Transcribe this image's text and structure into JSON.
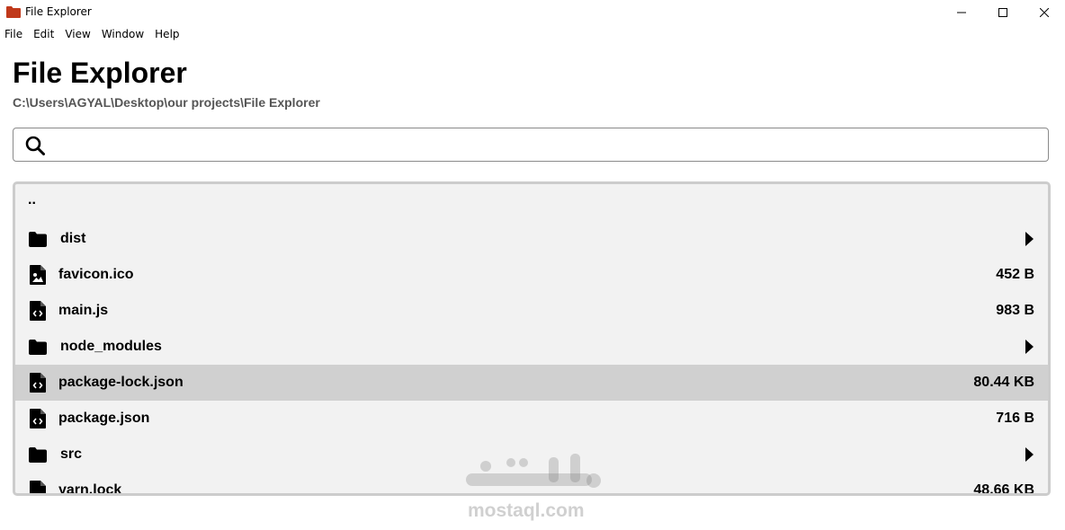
{
  "window": {
    "title": "File Explorer",
    "menu": [
      "File",
      "Edit",
      "View",
      "Window",
      "Help"
    ]
  },
  "header": {
    "title": "File Explorer",
    "path": "C:\\Users\\AGYAL\\Desktop\\our projects\\File Explorer"
  },
  "search": {
    "value": "",
    "placeholder": ""
  },
  "files": [
    {
      "name": "..",
      "type": "parent",
      "size": ""
    },
    {
      "name": "dist",
      "type": "folder",
      "size": ""
    },
    {
      "name": "favicon.ico",
      "type": "image",
      "size": "452 B"
    },
    {
      "name": "main.js",
      "type": "code",
      "size": "983 B"
    },
    {
      "name": "node_modules",
      "type": "folder",
      "size": ""
    },
    {
      "name": "package-lock.json",
      "type": "code",
      "size": "80.44 KB",
      "selected": true
    },
    {
      "name": "package.json",
      "type": "code",
      "size": "716 B"
    },
    {
      "name": "src",
      "type": "folder",
      "size": ""
    },
    {
      "name": "yarn.lock",
      "type": "file",
      "size": "48.66 KB"
    }
  ],
  "watermark": {
    "text": "mostaql.com"
  },
  "colors": {
    "app_icon": "#c0391b",
    "selected_row": "#d0d0d0",
    "panel_bg": "#f2f2f2"
  }
}
